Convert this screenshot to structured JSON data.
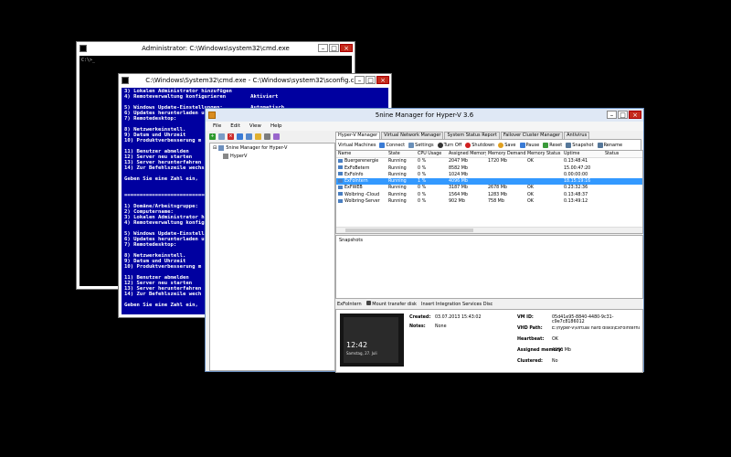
{
  "cmd1": {
    "title": "Administrator: C:\\Windows\\system32\\cmd.exe",
    "console": "C:\\>_"
  },
  "cmd2": {
    "title": "C:\\Windows\\System32\\cmd.exe - C:\\Windows\\system32\\sconfig.cmd",
    "console": "3) Lokalen Administrator hinzufügen\n4) Remoteverwaltung konfigurieren        Aktiviert\n\n5) Windows Update-Einstellungen:         Automatisch\n6) Updates herunterladen und installieren\n7) Remotedesktop:\n\n8) Netzwerkeinstell.\n9) Datum und Uhrzeit\n10) Produktverbesserung m\n\n11) Benutzer abmelden\n12) Server neu starten\n13) Server herunterfahren\n14) Zur Befehlszeile wechs\n\nGeben Sie eine Zahl ein, \n\n\n=================================\n\n1) Domäne/Arbeitsgruppe:\n2) Computername:\n3) Lokalen Administrator h\n4) Remoteverwaltung konfig\n\n5) Windows Update-Einstell\n6) Updates herunterladen u\n7) Remotedesktop:\n\n8) Netzwerkeinstell.\n9) Datum und Uhrzeit\n10) Produktverbesserung m\n\n11) Benutzer abmelden\n12) Server neu starten\n13) Server herunterfahren\n14) Zur Befehlszeile wech\n\nGeben Sie eine Zahl ein,"
  },
  "hv": {
    "title": "5nine Manager for Hyper-V 3.6",
    "menu": [
      "File",
      "Edit",
      "View",
      "Help"
    ],
    "tree_root": "5nine Manager for Hyper-V",
    "tree_child": "HyperV",
    "tabs": [
      "Hyper-V Manager",
      "Virtual Network Manager",
      "System Status Report",
      "Failover Cluster Manager",
      "Antivirus"
    ],
    "vm_toolbar": {
      "label": "Virtual Machines",
      "buttons": [
        "Connect",
        "Settings",
        "Turn Off",
        "Shutdown",
        "Save",
        "Pause",
        "Reset",
        "Snapshot",
        "Rename"
      ]
    },
    "columns": [
      "Name",
      "State",
      "CPU Usage",
      "Assigned Memory",
      "Memory Demand",
      "Memory Status",
      "Uptime",
      "Status"
    ],
    "rows": [
      [
        "Buergerenergie",
        "Running",
        "0 %",
        "2047 Mb",
        "1720 Mb",
        "OK",
        "0.13:48:41",
        ""
      ],
      [
        "ExFoBetern",
        "Running",
        "0 %",
        "8582 Mb",
        "",
        "",
        "15.00:47:20",
        ""
      ],
      [
        "ExFoInfo",
        "Running",
        "0 %",
        "1024 Mb",
        "",
        "",
        "0.00:00:00",
        ""
      ],
      [
        "ExFoIntern",
        "Running",
        "1 %",
        "4096 Mb",
        "",
        "",
        "18.15:19:16",
        ""
      ],
      [
        "ExFWEB",
        "Running",
        "0 %",
        "3187 Mb",
        "2678 Mb",
        "OK",
        "0.23:32:36",
        ""
      ],
      [
        "Wolbring -Cloud",
        "Running",
        "0 %",
        "1564 Mb",
        "1283 Mb",
        "OK",
        "0.13:48:37",
        ""
      ],
      [
        "Wolbring-Server",
        "Running",
        "0 %",
        "902 Mb",
        "758 Mb",
        "OK",
        "0.13:49:12",
        ""
      ]
    ],
    "selected_row": 3,
    "snapshots_label": "Snapshots",
    "detail_tabs": [
      "ExFoIntern",
      "Mount transfer disk",
      "Insert Integration Services Disc"
    ],
    "details": {
      "created_label": "Created:",
      "created": "03.07.2013 15:43:02",
      "notes_label": "Notes:",
      "notes": "None",
      "vmid_label": "VM ID:",
      "vmid": "05d41e95-8840-4480-9c31-c9e7c8186012",
      "vhd_label": "VHD Path:",
      "vhd": "E:\\hyper-v\\virtual hard disks\\ExFoInternalSys",
      "heartbeat_label": "Heartbeat:",
      "heartbeat": "OK",
      "mem_label": "Assigned memory:",
      "mem": "4096 Mb",
      "clustered_label": "Clustered:",
      "clustered": "No",
      "clock": "12:42",
      "clock_date": "Samstag, 27. Juli"
    }
  }
}
